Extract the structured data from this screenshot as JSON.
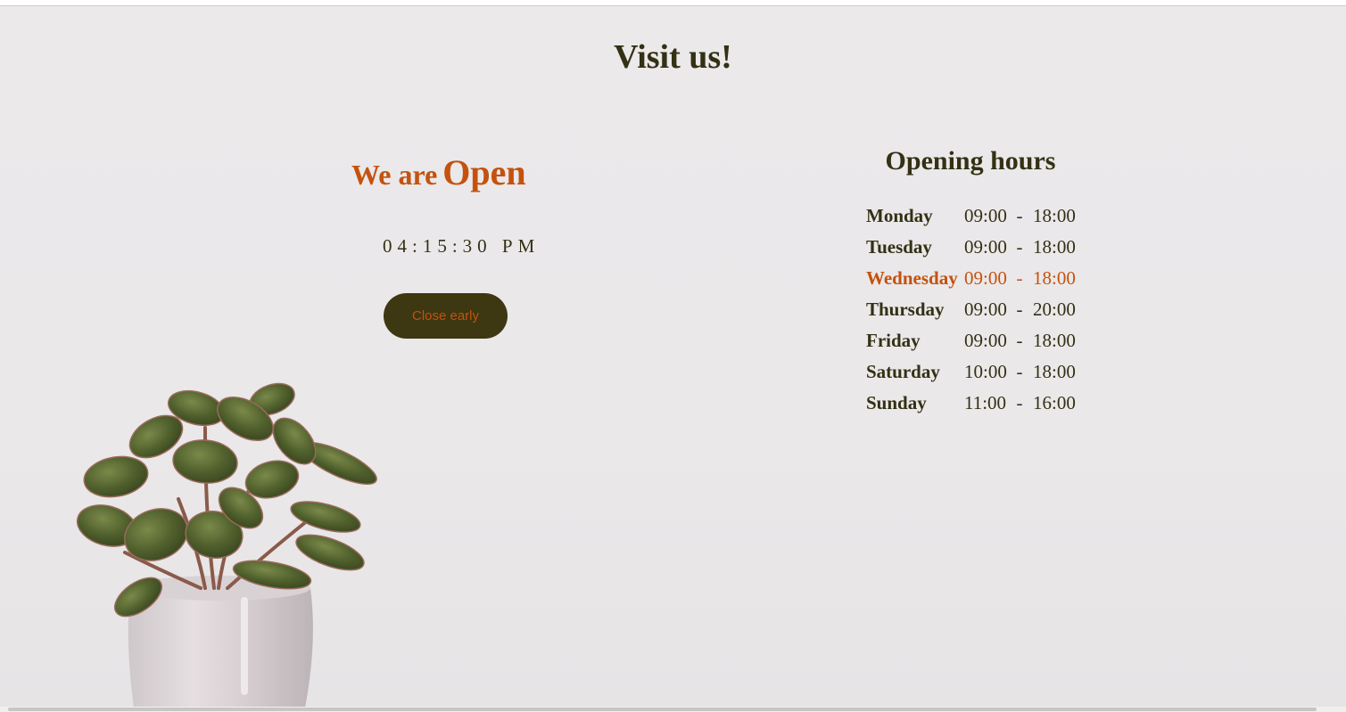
{
  "header": {
    "title": "Visit us!"
  },
  "status": {
    "prefix": "We are",
    "state": "Open",
    "time": "04:15:30 PM",
    "button_label": "Close early"
  },
  "hours": {
    "title": "Opening hours",
    "separator": "-",
    "today": "Wednesday",
    "days": [
      {
        "day": "Monday",
        "open": "09:00",
        "close": "18:00"
      },
      {
        "day": "Tuesday",
        "open": "09:00",
        "close": "18:00"
      },
      {
        "day": "Wednesday",
        "open": "09:00",
        "close": "18:00"
      },
      {
        "day": "Thursday",
        "open": "09:00",
        "close": "20:00"
      },
      {
        "day": "Friday",
        "open": "09:00",
        "close": "18:00"
      },
      {
        "day": "Saturday",
        "open": "10:00",
        "close": "18:00"
      },
      {
        "day": "Sunday",
        "open": "11:00",
        "close": "16:00"
      }
    ]
  },
  "colors": {
    "accent": "#c4520e",
    "text": "#333014",
    "button_bg": "#3d3712",
    "background": "#eae8e9"
  },
  "decor": {
    "illustration": "potted-plant-icon"
  }
}
